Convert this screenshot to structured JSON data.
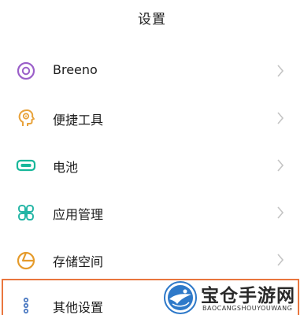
{
  "header": {
    "title": "设置"
  },
  "settings": {
    "items": [
      {
        "label": "Breeno",
        "icon": "breeno-icon",
        "color": "#9b5fc9"
      },
      {
        "label": "便捷工具",
        "icon": "convenient-tools-icon",
        "color": "#e8a23a"
      },
      {
        "label": "电池",
        "icon": "battery-icon",
        "color": "#17b79a"
      },
      {
        "label": "应用管理",
        "icon": "app-management-icon",
        "color": "#23b5a5"
      },
      {
        "label": "存储空间",
        "icon": "storage-icon",
        "color": "#e59b2b"
      },
      {
        "label": "其他设置",
        "icon": "other-settings-icon",
        "color": "#4d7bc2"
      }
    ]
  },
  "highlight": {
    "color": "#e9763e"
  },
  "watermark": {
    "title": "宝仓手游网",
    "subtitle": "BAOCANGSHOUYOUWANG"
  }
}
